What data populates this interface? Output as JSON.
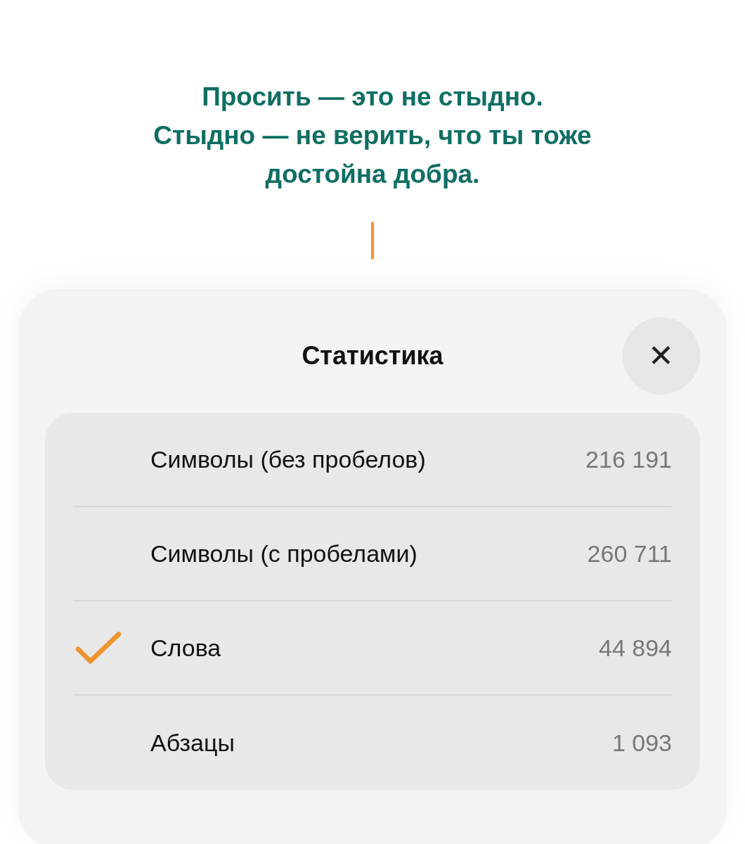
{
  "document": {
    "heading_lines": [
      "Просить — это не стыдно.",
      "Стыдно — не верить, что ты тоже",
      "достойна добра."
    ]
  },
  "sheet": {
    "title": "Статистика",
    "close": "✕",
    "rows": [
      {
        "label": "Символы (без пробелов)",
        "value": "216 191",
        "selected": false
      },
      {
        "label": "Символы (с пробелами)",
        "value": "260 711",
        "selected": false
      },
      {
        "label": "Слова",
        "value": "44 894",
        "selected": true
      },
      {
        "label": "Абзацы",
        "value": "1 093",
        "selected": false
      }
    ]
  }
}
